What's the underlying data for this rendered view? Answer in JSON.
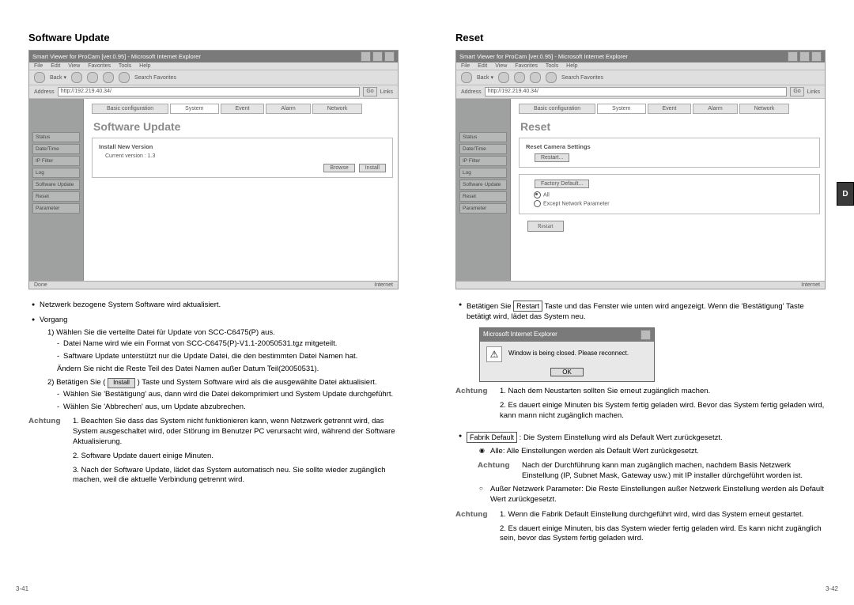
{
  "left": {
    "title": "Software Update",
    "screenshot": {
      "window_title": "Smart Viewer for ProCam [ver.0.95] - Microsoft Internet Explorer",
      "menubar": [
        "File",
        "Edit",
        "View",
        "Favorites",
        "Tools",
        "Help"
      ],
      "toolbar_text": "Search   Favorites",
      "address_prefix": "Address",
      "address": "http://192.219.40.34/",
      "go": "Go",
      "links": "Links",
      "sidebar": [
        "Status",
        "Date/Time",
        "IP Filter",
        "Log",
        "Software Update",
        "Reset",
        "Parameter"
      ],
      "tabs": [
        "Basic configuration",
        "System",
        "Event",
        "Alarm",
        "Network"
      ],
      "active_tab": 1,
      "panel_title": "Software Update",
      "box_label": "Install New Version",
      "current_version": "Current version : 1.3",
      "btn_browse": "Browse",
      "btn_install": "Install",
      "status_left": "Done",
      "status_right": "Internet"
    },
    "bullets": [
      "Netzwerk bezogene System Software wird aktualisiert.",
      "Vorgang"
    ],
    "steps": [
      {
        "num": "1)",
        "text": "Wählen Sie die verteilte Datei für Update von SCC-C6475(P) aus.",
        "dashes": [
          "Datei Name wird wie ein Format von SCC-C6475(P)-V1.1-20050531.tgz mitgeteilt.",
          "Saftware Update unterstützt nur die Update Datei, die den bestimmten Datei Namen hat.",
          "Ändern Sie nicht die Reste Teil des Datei Namen außer Datum Teil(20050531)."
        ]
      },
      {
        "num": "2)",
        "text_a": "Betätigen Sie (",
        "install_btn": "Install",
        "text_b": ") Taste und System Software wird als die ausgewählte Datei aktualisiert.",
        "dashes": [
          "Wählen Sie 'Bestätigung' aus, dann wird die Datei dekomprimiert und System Update durchgeführt.",
          "Wählen Sie 'Abbrechen' aus, um Update abzubrechen."
        ]
      }
    ],
    "achtung_label": "Achtung",
    "achtung": [
      "1. Beachten Sie dass das System nicht funktionieren kann, wenn Netzwerk getrennt wird, das System ausgeschaltet wird, oder Störung im Benutzer PC verursacht wird, während der Software Aktualisierung.",
      "2. Software Update dauert einige Minuten.",
      "3. Nach der Software Update, lädet das System automatisch neu. Sie sollte wieder zugänglich machen, weil die aktuelle Verbindung getrennt wird."
    ],
    "page_num": "3-41"
  },
  "right": {
    "title": "Reset",
    "screenshot": {
      "window_title": "Smart Viewer for ProCam [ver.0.95] - Microsoft Internet Explorer",
      "menubar": [
        "File",
        "Edit",
        "View",
        "Favorites",
        "Tools",
        "Help"
      ],
      "toolbar_text": "Search   Favorites",
      "address_prefix": "Address",
      "address": "http://192.219.40.34/",
      "go": "Go",
      "links": "Links",
      "sidebar": [
        "Status",
        "Date/Time",
        "IP Filter",
        "Log",
        "Software Update",
        "Reset",
        "Parameter"
      ],
      "tabs": [
        "Basic configuration",
        "System",
        "Event",
        "Alarm",
        "Network"
      ],
      "active_tab": 1,
      "panel_title": "Reset",
      "box1_label": "Reset Camera Settings",
      "btn_restart_s": "Restart...",
      "btn_factory": "Factory Default...",
      "radio_all": "All",
      "radio_except": "Except Network Parameter",
      "btn_restart": "Restart",
      "status_left": "",
      "status_right": "Internet"
    },
    "bullet1_a": "Betätigen Sie ",
    "bullet1_btn": "Restart",
    "bullet1_b": " Taste und das Fenster wie unten wird angezeigt. Wenn die 'Bestätigung' Taste betätigt wird, lädet das System neu.",
    "dialog": {
      "title": "Microsoft Internet Explorer",
      "msg": "Window is being closed. Please reconnect.",
      "ok": "OK"
    },
    "achtung_label": "Achtung",
    "achtung1": [
      "1. Nach dem Neustarten sollten Sie erneut zugänglich machen.",
      "2. Es dauert einige Minuten bis System fertig geladen wird. Bevor das System fertig geladen wird, kann mann nicht zugänglich machen."
    ],
    "bullet2_btn": "Fabrik Default",
    "bullet2_text": " : Die System Einstellung wird als Default Wert zurückgesetzt.",
    "radio_filled": "Alle: Alle Einstellungen werden als Default Wert zurückgesetzt.",
    "achtung2": "Nach der Durchführung kann man zugänglich machen, nachdem Basis Netzwerk Einstellung (IP, Subnet Mask, Gateway usw.) mit IP installer dürchgeführt worden ist.",
    "radio_open": "Außer Netzwerk Parameter: Die Reste Einstellungen außer Netzwerk Einstellung werden als Default Wert zurückgesetzt.",
    "achtung3": [
      "1. Wenn die Fabrik Default Einstellung durchgeführt wird, wird das System erneut gestartet.",
      "2. Es dauert einige Minuten, bis das System wieder fertig geladen wird. Es kann nicht zugänglich sein, bevor das System fertig geladen wird."
    ],
    "page_num": "3-42",
    "side_tab": "D"
  }
}
